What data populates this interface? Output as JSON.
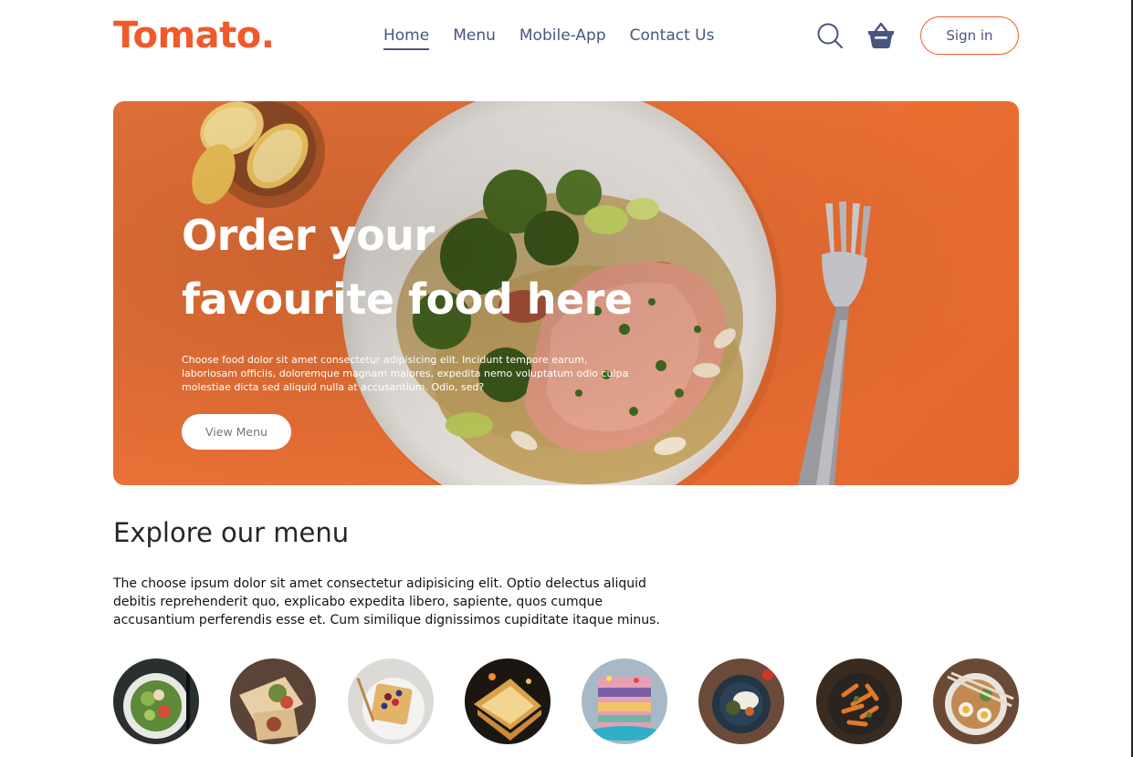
{
  "brand": {
    "name": "Tomato.",
    "color": "#ef5a2c"
  },
  "nav": {
    "links": [
      "Home",
      "Menu",
      "Mobile-App",
      "Contact Us"
    ],
    "active": "Home",
    "search_icon": "search-icon",
    "basket_icon": "basket-icon",
    "signin_label": "Sign in"
  },
  "hero": {
    "title_line1": "Order your",
    "title_line2": "favourite food here",
    "description": "Choose food dolor sit amet consectetur adipisicing elit. Incidunt tempore earum, laboriosam officiis, doloremque magnam maiores, expedita nemo voluptatum odio culpa molestiae dicta sed aliquid nulla at accusantium. Odio, sed?",
    "button_label": "View Menu",
    "background_color": "#ec7134"
  },
  "explore": {
    "title": "Explore our menu",
    "text": "The choose ipsum dolor sit amet consectetur adipisicing elit. Optio delectus aliquid debitis reprehenderit quo, explicabo expedita libero, sapiente, quos cumque accusantium perferendis esse et. Cum similique dignissimos cupiditate itaque minus.",
    "items": [
      "salad",
      "rolls",
      "waffles",
      "sandwich",
      "cake",
      "rice-bowl",
      "pasta",
      "noodles"
    ]
  }
}
